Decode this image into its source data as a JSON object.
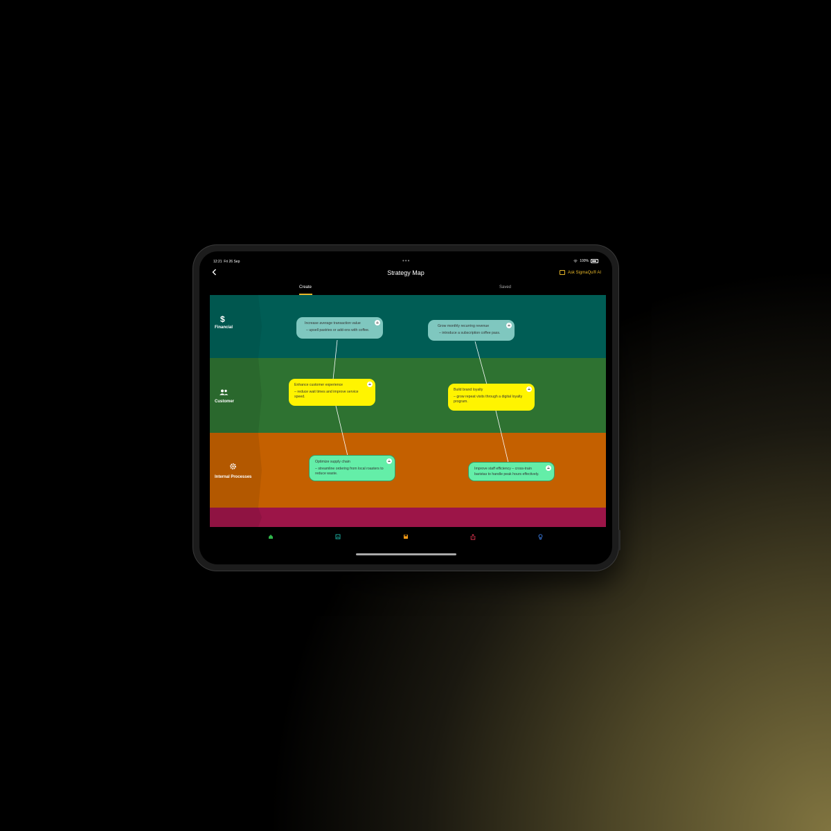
{
  "status": {
    "time": "12:21",
    "date": "Fri 26 Sep",
    "battery": "100%"
  },
  "nav": {
    "back_icon": "chevron-left-icon",
    "title": "Strategy Map",
    "ask_label": "Ask SigmaQu® AI"
  },
  "tabs": [
    {
      "label": "Create",
      "active": true
    },
    {
      "label": "Saved",
      "active": false
    }
  ],
  "map": {
    "bands": [
      {
        "label": "Financial",
        "icon": "dollar-icon",
        "color": "#005d55",
        "label_color": "#00574f"
      },
      {
        "label": "Customer",
        "icon": "people-icon",
        "color": "#2e7231",
        "label_color": "#2a682d"
      },
      {
        "label": "Internal Processes",
        "icon": "gear-icon",
        "color": "#c46000",
        "label_color": "#b35800"
      },
      {
        "label": "",
        "icon": "",
        "color": "#9c1548",
        "label_color": "#8f1342"
      }
    ],
    "cards": [
      {
        "title": "Increase average transaction value",
        "detail": "– upsell pastries or add-ons with coffee.",
        "color": "#7fc7bf"
      },
      {
        "title": "Grow monthly recurring revenue",
        "detail": "– introduce a subscription coffee pass.",
        "color": "#7fc7bf"
      },
      {
        "title": "Enhance customer experience",
        "detail": "– reduce wait times and improve service speed.",
        "color": "#fff400"
      },
      {
        "title": "Build brand loyalty",
        "detail": "– grow repeat visits through a digital loyalty program.",
        "color": "#fff400"
      },
      {
        "title": "Optimize supply chain",
        "detail": "– streamline ordering from local roasters to reduce waste.",
        "color": "#64eea8"
      },
      {
        "title": "Improve staff efficiency – cross-train baristas to handle peak hours effectively.",
        "detail": "",
        "color": "#64eea8"
      }
    ]
  },
  "bottom_bar": [
    {
      "icon": "home-icon",
      "color": "#2fb34a"
    },
    {
      "icon": "image-icon",
      "color": "#1aa89a"
    },
    {
      "icon": "save-icon",
      "color": "#f39a16"
    },
    {
      "icon": "share-icon",
      "color": "#e0344f"
    },
    {
      "icon": "lightbulb-icon",
      "color": "#3a7be0"
    }
  ]
}
